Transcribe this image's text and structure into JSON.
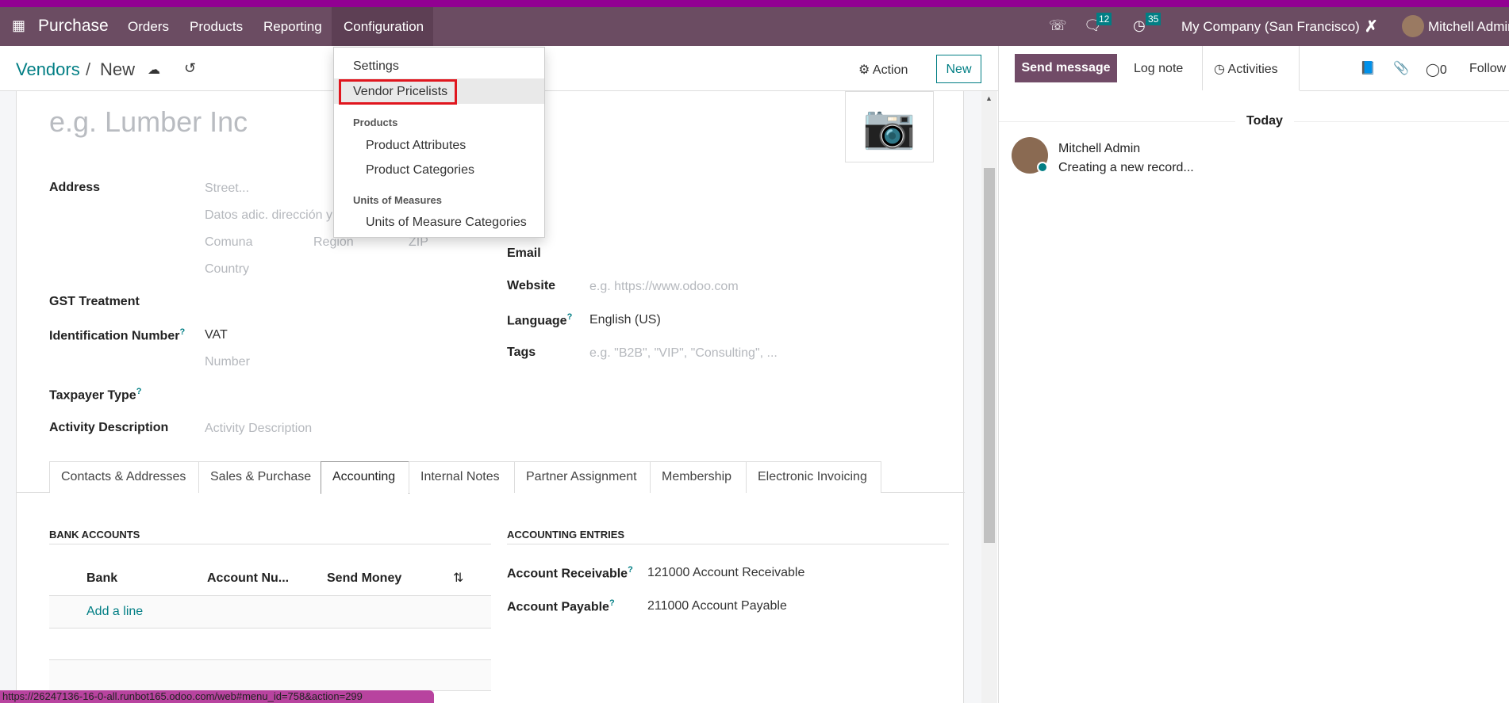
{
  "navbar": {
    "app_name": "Purchase",
    "menus": [
      "Orders",
      "Products",
      "Reporting",
      "Configuration"
    ],
    "messages_count": "12",
    "activities_count": "35",
    "company": "My Company (San Francisco)",
    "user": "Mitchell Admin",
    "accent": "#6b4c62"
  },
  "dropdown": {
    "settings": "Settings",
    "vendor_pricelists": "Vendor Pricelists",
    "products_header": "Products",
    "product_attributes": "Product Attributes",
    "product_categories": "Product Categories",
    "uom_header": "Units of Measures",
    "uom_categories": "Units of Measure Categories"
  },
  "control_panel": {
    "breadcrumb_parent": "Vendors",
    "breadcrumb_sep": "/",
    "breadcrumb_current": "New",
    "action_label": "Action",
    "new_label": "New"
  },
  "form": {
    "name_placeholder": "e.g. Lumber Inc",
    "address_label": "Address",
    "street_ph": "Street...",
    "street2_ph": "Datos adic. dirección y",
    "city_ph": "Comuna",
    "state_ph": "Region",
    "zip_ph": "ZIP",
    "country_ph": "Country",
    "gst_label": "GST Treatment",
    "id_label": "Identification Number",
    "id_type": "VAT",
    "id_number_ph": "Number",
    "taxpayer_label": "Taxpayer Type",
    "activity_label": "Activity Description",
    "activity_ph": "Activity Description",
    "email_label": "Email",
    "website_label": "Website",
    "website_ph": "e.g. https://www.odoo.com",
    "language_label": "Language",
    "language_value": "English (US)",
    "tags_label": "Tags",
    "tags_ph": "e.g. \"B2B\", \"VIP\", \"Consulting\", ...",
    "help_mark": "?"
  },
  "tabs": [
    "Contacts & Addresses",
    "Sales & Purchase",
    "Accounting",
    "Internal Notes",
    "Partner Assignment",
    "Membership",
    "Electronic Invoicing"
  ],
  "active_tab": "Accounting",
  "accounting": {
    "bank_title": "BANK ACCOUNTS",
    "columns": [
      "Bank",
      "Account Nu...",
      "Send Money"
    ],
    "add_line": "Add a line",
    "entries_title": "ACCOUNTING ENTRIES",
    "receivable_label": "Account Receivable",
    "receivable_value": "121000 Account Receivable",
    "payable_label": "Account Payable",
    "payable_value": "211000 Account Payable"
  },
  "chatter": {
    "send_message": "Send message",
    "log_note": "Log note",
    "activities": "Activities",
    "followers_count": "0",
    "follow": "Follow",
    "date_separator": "Today",
    "author": "Mitchell Admin",
    "message": "Creating a new record..."
  },
  "status_url": "https://26247136-16-0-all.runbot165.odoo.com/web#menu_id=758&action=299"
}
